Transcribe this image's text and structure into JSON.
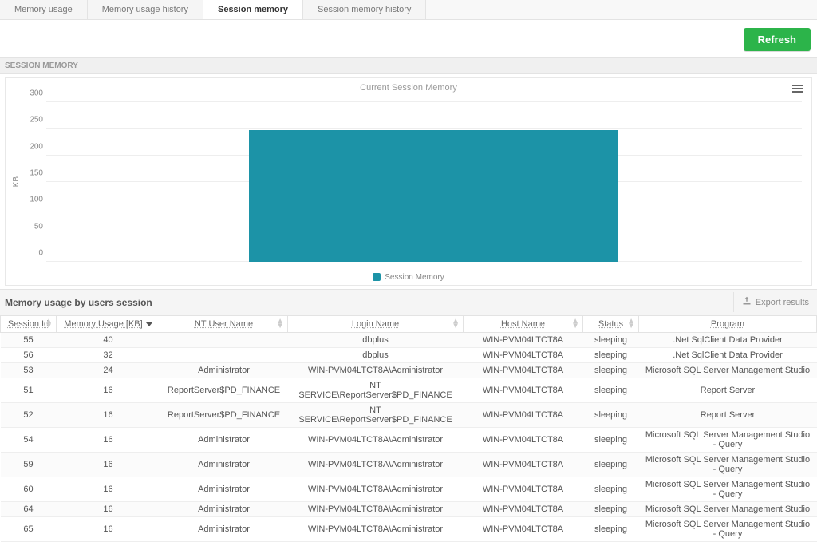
{
  "tabs": [
    {
      "label": "Memory usage",
      "active": false
    },
    {
      "label": "Memory usage history",
      "active": false
    },
    {
      "label": "Session memory",
      "active": true
    },
    {
      "label": "Session memory history",
      "active": false
    }
  ],
  "buttons": {
    "refresh": "Refresh",
    "export": "Export results"
  },
  "sections": {
    "session_memory": "SESSION MEMORY",
    "lower": "Memory usage by users session"
  },
  "chart": {
    "title": "Current Session Memory",
    "legend": "Session Memory",
    "yaxis": "KB"
  },
  "chart_data": {
    "type": "bar",
    "categories": [
      "Session Memory"
    ],
    "values": [
      248
    ],
    "title": "Current Session Memory",
    "xlabel": "",
    "ylabel": "KB",
    "ylim": [
      0,
      300
    ],
    "yticks": [
      0,
      50,
      100,
      150,
      200,
      250,
      300
    ],
    "color": "#1c93a7"
  },
  "columns": [
    "Session Id",
    "Memory Usage [KB]",
    "NT User Name",
    "Login Name",
    "Host Name",
    "Status",
    "Program"
  ],
  "sort": {
    "column": 1,
    "dir": "desc"
  },
  "rows": [
    {
      "sid": 55,
      "mem": 40,
      "user": "",
      "login": "dbplus",
      "host": "WIN-PVM04LTCT8A",
      "status": "sleeping",
      "program": ".Net SqlClient Data Provider"
    },
    {
      "sid": 56,
      "mem": 32,
      "user": "",
      "login": "dbplus",
      "host": "WIN-PVM04LTCT8A",
      "status": "sleeping",
      "program": ".Net SqlClient Data Provider"
    },
    {
      "sid": 53,
      "mem": 24,
      "user": "Administrator",
      "login": "WIN-PVM04LTCT8A\\Administrator",
      "host": "WIN-PVM04LTCT8A",
      "status": "sleeping",
      "program": "Microsoft SQL Server Management Studio"
    },
    {
      "sid": 51,
      "mem": 16,
      "user": "ReportServer$PD_FINANCE",
      "login": "NT SERVICE\\ReportServer$PD_FINANCE",
      "host": "WIN-PVM04LTCT8A",
      "status": "sleeping",
      "program": "Report Server"
    },
    {
      "sid": 52,
      "mem": 16,
      "user": "ReportServer$PD_FINANCE",
      "login": "NT SERVICE\\ReportServer$PD_FINANCE",
      "host": "WIN-PVM04LTCT8A",
      "status": "sleeping",
      "program": "Report Server"
    },
    {
      "sid": 54,
      "mem": 16,
      "user": "Administrator",
      "login": "WIN-PVM04LTCT8A\\Administrator",
      "host": "WIN-PVM04LTCT8A",
      "status": "sleeping",
      "program": "Microsoft SQL Server Management Studio - Query"
    },
    {
      "sid": 59,
      "mem": 16,
      "user": "Administrator",
      "login": "WIN-PVM04LTCT8A\\Administrator",
      "host": "WIN-PVM04LTCT8A",
      "status": "sleeping",
      "program": "Microsoft SQL Server Management Studio - Query"
    },
    {
      "sid": 60,
      "mem": 16,
      "user": "Administrator",
      "login": "WIN-PVM04LTCT8A\\Administrator",
      "host": "WIN-PVM04LTCT8A",
      "status": "sleeping",
      "program": "Microsoft SQL Server Management Studio - Query"
    },
    {
      "sid": 64,
      "mem": 16,
      "user": "Administrator",
      "login": "WIN-PVM04LTCT8A\\Administrator",
      "host": "WIN-PVM04LTCT8A",
      "status": "sleeping",
      "program": "Microsoft SQL Server Management Studio"
    },
    {
      "sid": 65,
      "mem": 16,
      "user": "Administrator",
      "login": "WIN-PVM04LTCT8A\\Administrator",
      "host": "WIN-PVM04LTCT8A",
      "status": "sleeping",
      "program": "Microsoft SQL Server Management Studio - Query"
    }
  ]
}
